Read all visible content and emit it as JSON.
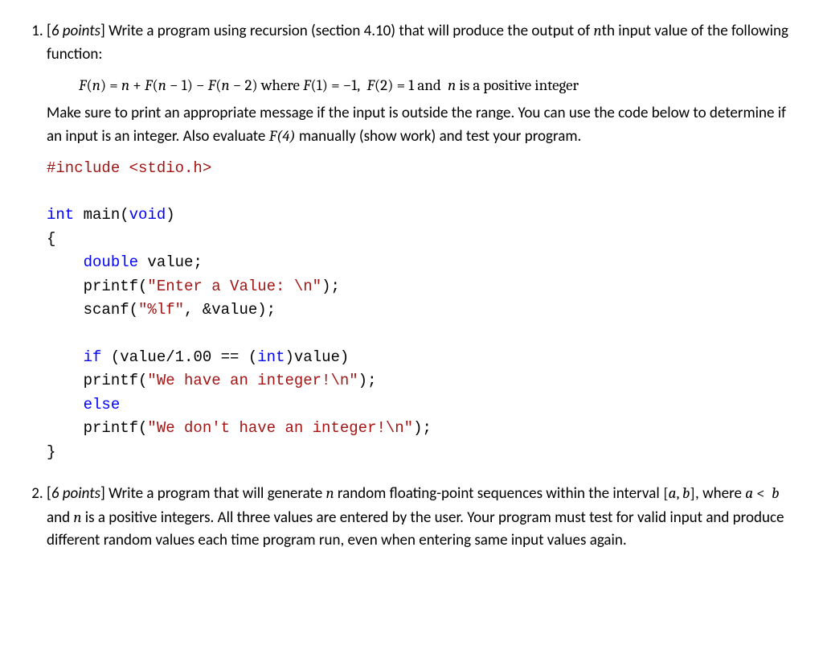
{
  "q1": {
    "points_label": "6 points",
    "prompt_a": "Write a program using recursion (section 4.10) that will produce the output of ",
    "prompt_nth": "n",
    "prompt_b": "th input value of the following function:",
    "formula": "F(n) = n + F(n − 1) − F(n − 2) where F(1) = −1,  F(2) = 1 and  n is a positive integer",
    "para2_a": "Make sure to print an appropriate message if the input is outside the range.  You can use the code below to determine if an input is an integer.  Also evaluate ",
    "para2_fx": "F(4)",
    "para2_b": " manually (show work) and test your program.",
    "code": {
      "l1a": "#include",
      "l1b": " <stdio.h>",
      "l3a": "int",
      "l3b": " main(",
      "l3c": "void",
      "l3d": ")",
      "l4": "{",
      "l5a": "    double",
      "l5b": " value;",
      "l6a": "    printf(",
      "l6b": "\"Enter a Value: \\n\"",
      "l6c": ");",
      "l7a": "    scanf(",
      "l7b": "\"%lf\"",
      "l7c": ", &value);",
      "l9a": "    if",
      "l9b": " (value/1.00 == (",
      "l9c": "int",
      "l9d": ")value)",
      "l10a": "    printf(",
      "l10b": "\"We have an integer!\\n\"",
      "l10c": ");",
      "l11a": "    else",
      "l12a": "    printf(",
      "l12b": "\"We don't have an integer!\\n\"",
      "l12c": ");",
      "l13": "}"
    }
  },
  "q2": {
    "points_label": "6 points",
    "text_a": "Write a program that will generate ",
    "text_n": "n",
    "text_b": " random floating-point sequences within the interval ",
    "interval": "[a, b]",
    "text_c": ", where ",
    "cond": "a <  b",
    "text_d": "  and ",
    "text_n2": "n",
    "text_e": " is a positive integers.  All three values are entered by the user.  Your program must test for valid input and produce different random values each time program run, even when entering same input values again."
  }
}
